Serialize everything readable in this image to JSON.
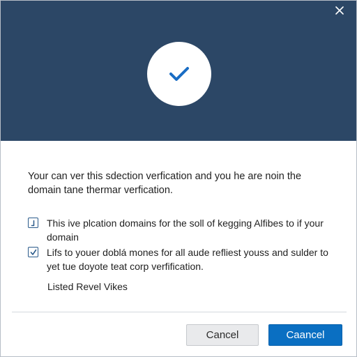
{
  "header": {
    "close_icon": "close-icon",
    "status_icon": "checkmark-icon",
    "background_color": "#2c4766",
    "accent_color": "#1a6dc4"
  },
  "content": {
    "description": "Your can ver this sdection verfication and you he are noin the domain tane thermar verfication.",
    "options": [
      {
        "label": "This ive plcation domains for the soll of kegging Alfibes to if your domain",
        "checked": true
      },
      {
        "label": "Lifs to youer doblá mones for all aude refliest youss and sulder to yet tue doyote teat corp verfification.",
        "checked": true
      }
    ],
    "footnote": "Listed Revel Vikes"
  },
  "footer": {
    "cancel_label": "Cancel",
    "confirm_label": "Caancel",
    "confirm_color": "#0a6fc2"
  }
}
